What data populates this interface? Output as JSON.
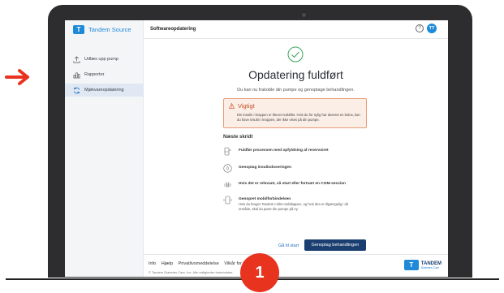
{
  "colors": {
    "accent": "#1f8ad7",
    "primary_button": "#1a3e6f",
    "warning": "#c5512a",
    "warning_bg": "#fbeee6",
    "success": "#3aa55a",
    "marker": "#e8331e"
  },
  "sidebar": {
    "brand": "Tandem Source",
    "brand_icon": "tandem-logo-icon",
    "items": [
      {
        "label": "Udlæs upp pump",
        "icon": "upload-icon",
        "active": false
      },
      {
        "label": "Rapporter",
        "icon": "bar-chart-icon",
        "active": false
      },
      {
        "label": "Mjøkvareopdatering",
        "icon": "sync-icon",
        "active": true
      }
    ]
  },
  "topbar": {
    "title": "Softwareopdatering",
    "help_icon": "help-icon",
    "avatar_initials": "TT"
  },
  "main": {
    "status_icon": "check-circle-icon",
    "title": "Opdatering fuldført",
    "subtitle": "Du kan nu frakoble din pumpe og genoptage behandlingen.",
    "warning": {
      "icon": "warning-icon",
      "title": "Vigtigt",
      "text": "Din insulin i kroppen er blevet nulstillet. Hvis du for nylig har doseret en bolus, kan du have insulin i kroppen, der ikke vises på din pumpe."
    },
    "next_steps_title": "Næste skridt",
    "steps": [
      {
        "icon": "cartridge-icon",
        "label": "Fuldfør processen med opfyldning af reservoiret",
        "desc": ""
      },
      {
        "icon": "insulin-drop-icon",
        "label": "Genoptag insulindoseringen",
        "desc": ""
      },
      {
        "icon": "cgm-sensor-icon",
        "label": "Hvis det er relevant, så start eller fortsæt en CGM-session",
        "desc": ""
      },
      {
        "icon": "phone-icon",
        "label": "Genopret mobilforbindelsen",
        "desc": "Hvis du bruger Tandem t:slim-mobilappen, og hvis den er tilgængelig i dit område, skal du parre din pumpe på ny."
      }
    ],
    "link_button": "Gå til start",
    "primary_button": "Genoptag behandlingen"
  },
  "footer": {
    "links": [
      "Info",
      "Hjælp",
      "Privatlivsmeddelelse",
      "Vilkår for brug"
    ],
    "copyright": "© Tandem Diabetes Care, Inc. Alle rettigheder forbeholdes.",
    "logo_title": "TANDEM",
    "logo_sub": "Diabetes Care"
  },
  "annotation": {
    "number": "1",
    "arrow_icon": "arrow-right-icon"
  }
}
